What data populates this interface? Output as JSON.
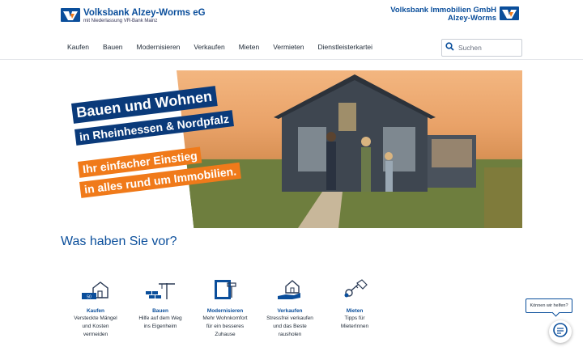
{
  "header": {
    "brand_left": "Volksbank Alzey-Worms eG",
    "brand_left_sub": "mit Niederlassung VR-Bank Mainz",
    "brand_right_line1": "Volksbank Immobilien GmbH",
    "brand_right_line2": "Alzey-Worms",
    "logo_icon": "volksbank-logo-icon"
  },
  "nav": {
    "items": [
      {
        "label": "Kaufen"
      },
      {
        "label": "Bauen"
      },
      {
        "label": "Modernisieren"
      },
      {
        "label": "Verkaufen"
      },
      {
        "label": "Mieten"
      },
      {
        "label": "Vermieten"
      },
      {
        "label": "Dienstleisterkartei"
      }
    ]
  },
  "search": {
    "placeholder": "Suchen",
    "icon": "search-icon"
  },
  "hero": {
    "line1": "Bauen und Wohnen",
    "line2": "in Rheinhessen & Nordpfalz",
    "line3": "Ihr einfacher Einstieg",
    "line4": "in alles rund um Immobilien.",
    "colors": {
      "primary": "#0a3a7a",
      "accent": "#f07a1a"
    }
  },
  "main": {
    "section_title": "Was haben Sie vor?",
    "categories": [
      {
        "title": "Kaufen",
        "desc1": "Versteckte Mängel",
        "desc2": "und Kosten",
        "desc3": "vermeiden",
        "icon": "house-price-icon"
      },
      {
        "title": "Bauen",
        "desc1": "Hilfe auf dem Weg",
        "desc2": "ins Eigenheim",
        "desc3": "",
        "icon": "crane-bricks-icon"
      },
      {
        "title": "Modernisieren",
        "desc1": "Mehr Wohnkomfort",
        "desc2": "für ein besseres",
        "desc3": "Zuhause",
        "icon": "paint-roller-icon"
      },
      {
        "title": "Verkaufen",
        "desc1": "Stressfrei verkaufen",
        "desc2": "und das Beste",
        "desc3": "rausholen",
        "icon": "hand-house-icon"
      },
      {
        "title": "Mieten",
        "desc1": "Tipps für",
        "desc2": "MieterInnen",
        "desc3": "",
        "icon": "key-tag-icon"
      }
    ]
  },
  "chat": {
    "prompt": "Können wir helfen?",
    "icon": "chat-icon"
  },
  "colors": {
    "brand_blue": "#0a4e9b",
    "brand_orange": "#f07a1a"
  }
}
